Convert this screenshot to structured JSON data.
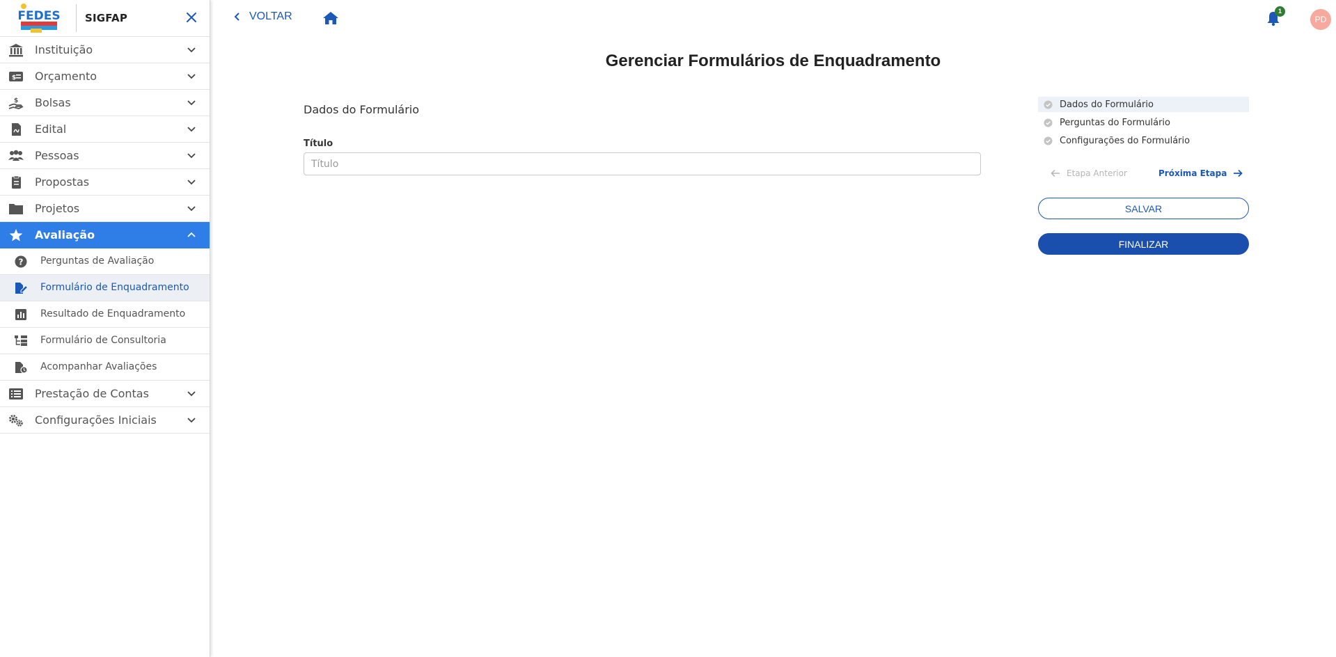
{
  "app": {
    "name": "SIGFAP",
    "logo_text": "FEDES"
  },
  "sidebar": {
    "items": [
      {
        "label": "Instituição",
        "icon": "institution-icon"
      },
      {
        "label": "Orçamento",
        "icon": "budget-icon"
      },
      {
        "label": "Bolsas",
        "icon": "hand-coin-icon"
      },
      {
        "label": "Edital",
        "icon": "document-icon"
      },
      {
        "label": "Pessoas",
        "icon": "people-icon"
      },
      {
        "label": "Propostas",
        "icon": "proposal-icon"
      },
      {
        "label": "Projetos",
        "icon": "folder-icon"
      },
      {
        "label": "Avaliação",
        "icon": "star-icon",
        "expanded": true
      },
      {
        "label": "Prestação de Contas",
        "icon": "list-icon"
      },
      {
        "label": "Configurações Iniciais",
        "icon": "gears-icon"
      }
    ],
    "sub_items": [
      {
        "label": "Perguntas de Avaliação",
        "icon": "question-circle-icon"
      },
      {
        "label": "Formulário de Enquadramento",
        "icon": "file-edit-icon",
        "selected": true
      },
      {
        "label": "Resultado de Enquadramento",
        "icon": "chart-bar-icon"
      },
      {
        "label": "Formulário de Consultoria",
        "icon": "tree-icon"
      },
      {
        "label": "Acompanhar Avaliações",
        "icon": "file-clock-icon"
      }
    ]
  },
  "topbar": {
    "back_label": "VOLTAR",
    "notification_count": "1",
    "user_initials": "PD"
  },
  "main": {
    "title": "Gerenciar Formulários de Enquadramento",
    "section_title": "Dados do Formulário",
    "field_label": "Título",
    "field_placeholder": "Título",
    "field_value": ""
  },
  "stepper": {
    "steps": [
      {
        "label": "Dados do Formulário",
        "current": true
      },
      {
        "label": "Perguntas do Formulário"
      },
      {
        "label": "Configurações do Formulário"
      }
    ],
    "prev_label": "Etapa Anterior",
    "next_label": "Próxima Etapa",
    "save_label": "SALVAR",
    "finish_label": "FINALIZAR"
  },
  "colors": {
    "primary": "#1b58b8",
    "active_menu": "#2f7de7",
    "button_dark": "#1b4fae",
    "badge": "#2e7d32",
    "avatar": "#f8a99e"
  }
}
